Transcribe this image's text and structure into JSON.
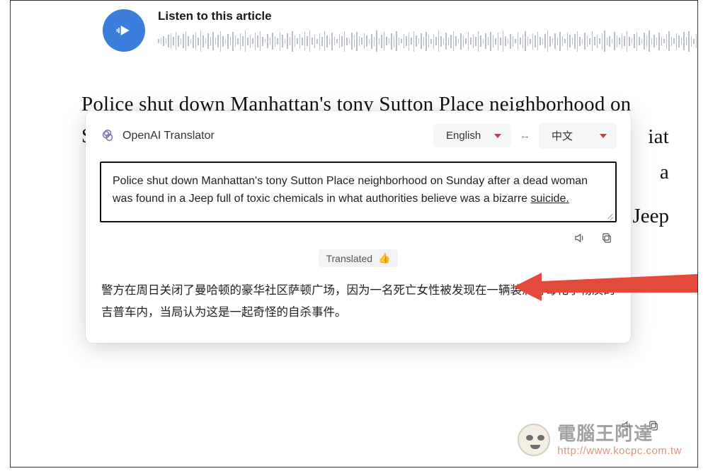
{
  "audio": {
    "title": "Listen to this article"
  },
  "article": {
    "headline": "Police shut down Manhattan's tony Sutton Place neighborhood on Sunday",
    "frag_a": "a",
    "frag_iat": "iat",
    "frag_a2": "a",
    "frag_jeep": "k Jeep"
  },
  "translator": {
    "brand": "OpenAI Translator",
    "lang_src": "English",
    "lang_dst": "中文",
    "swap": "↔",
    "source_text_a": "Police shut down Manhattan's tony Sutton Place neighborhood on Sunday after a dead woman was found in a Jeep full of toxic chemicals in what authorities believe was a bizarre ",
    "source_text_u": "suicide.",
    "status": "Translated",
    "thumb": "👍",
    "dest_text": "警方在周日关闭了曼哈顿的豪华社区萨顿广场，因为一名死亡女性被发现在一辆装满有毒化学物质的吉普车内，当局认为这是一起奇怪的自杀事件。"
  },
  "watermark": {
    "name": "電腦王阿達",
    "url": "http://www.kocpc.com.tw"
  }
}
